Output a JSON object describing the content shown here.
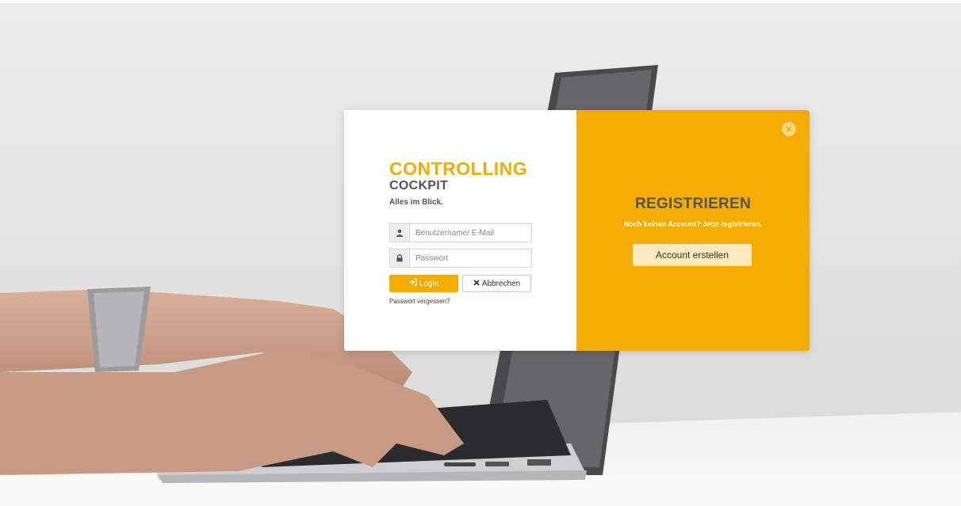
{
  "colors": {
    "accent": "#f5ab00",
    "accent_light": "#fde9bc",
    "text_dark": "#555555"
  },
  "login": {
    "brand_title": "CONTROLLING",
    "brand_subtitle": "COCKPIT",
    "tagline": "Alles im Blick.",
    "username_placeholder": "Benutzername/ E-Mail",
    "password_placeholder": "Passwort",
    "login_label": "Login",
    "cancel_label": "Abbrechen",
    "forgot_label": "Passwort vergessen?",
    "icons": {
      "username": "user-icon",
      "password": "lock-icon",
      "login": "sign-in-icon",
      "cancel": "times-icon"
    }
  },
  "register": {
    "title": "REGISTRIEREN",
    "subtitle": "Noch keinen Account? Jetzt registrieren.",
    "button_label": "Account erstellen",
    "close_icon": "close-circle-icon"
  }
}
